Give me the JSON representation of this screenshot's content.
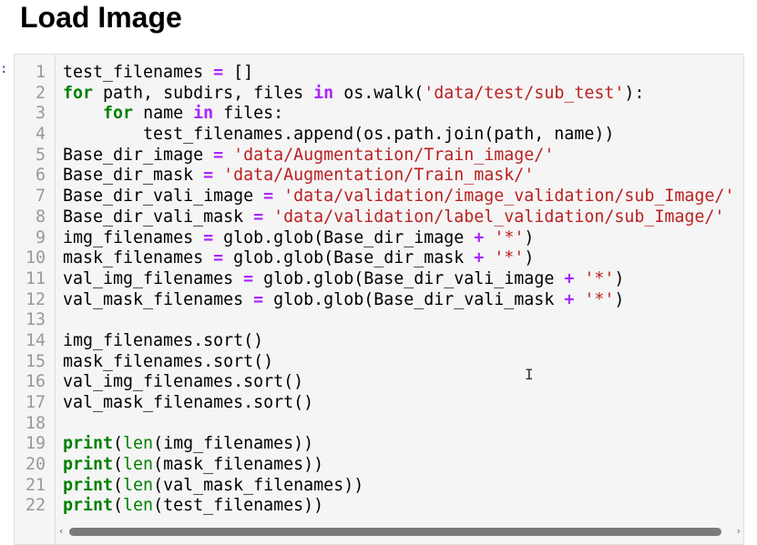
{
  "heading": "Load Image",
  "prompt": ":",
  "lines": [
    {
      "n": "1",
      "tokens": [
        [
          "t",
          "test_filenames "
        ],
        [
          "op",
          "="
        ],
        [
          "t",
          " []"
        ]
      ]
    },
    {
      "n": "2",
      "tokens": [
        [
          "kw",
          "for"
        ],
        [
          "t",
          " path, subdirs, files "
        ],
        [
          "op",
          "in"
        ],
        [
          "t",
          " os.walk("
        ],
        [
          "str",
          "'data/test/sub_test'"
        ],
        [
          "t",
          "):"
        ]
      ]
    },
    {
      "n": "3",
      "tokens": [
        [
          "t",
          "    "
        ],
        [
          "kw",
          "for"
        ],
        [
          "t",
          " name "
        ],
        [
          "op",
          "in"
        ],
        [
          "t",
          " files:"
        ]
      ]
    },
    {
      "n": "4",
      "tokens": [
        [
          "t",
          "        test_filenames.append(os.path.join(path, name))"
        ]
      ]
    },
    {
      "n": "5",
      "tokens": [
        [
          "t",
          "Base_dir_image "
        ],
        [
          "op",
          "="
        ],
        [
          "t",
          " "
        ],
        [
          "str",
          "'data/Augmentation/Train_image/'"
        ]
      ]
    },
    {
      "n": "6",
      "tokens": [
        [
          "t",
          "Base_dir_mask "
        ],
        [
          "op",
          "="
        ],
        [
          "t",
          " "
        ],
        [
          "str",
          "'data/Augmentation/Train_mask/'"
        ]
      ]
    },
    {
      "n": "7",
      "tokens": [
        [
          "t",
          "Base_dir_vali_image "
        ],
        [
          "op",
          "="
        ],
        [
          "t",
          " "
        ],
        [
          "str",
          "'data/validation/image_validation/sub_Image/'"
        ]
      ]
    },
    {
      "n": "8",
      "tokens": [
        [
          "t",
          "Base_dir_vali_mask "
        ],
        [
          "op",
          "="
        ],
        [
          "t",
          " "
        ],
        [
          "str",
          "'data/validation/label_validation/sub_Image/'"
        ]
      ]
    },
    {
      "n": "9",
      "tokens": [
        [
          "t",
          "img_filenames "
        ],
        [
          "op",
          "="
        ],
        [
          "t",
          " glob.glob(Base_dir_image "
        ],
        [
          "op",
          "+"
        ],
        [
          "t",
          " "
        ],
        [
          "str",
          "'*'"
        ],
        [
          "t",
          ")"
        ]
      ]
    },
    {
      "n": "10",
      "tokens": [
        [
          "t",
          "mask_filenames "
        ],
        [
          "op",
          "="
        ],
        [
          "t",
          " glob.glob(Base_dir_mask "
        ],
        [
          "op",
          "+"
        ],
        [
          "t",
          " "
        ],
        [
          "str",
          "'*'"
        ],
        [
          "t",
          ")"
        ]
      ]
    },
    {
      "n": "11",
      "tokens": [
        [
          "t",
          "val_img_filenames "
        ],
        [
          "op",
          "="
        ],
        [
          "t",
          " glob.glob(Base_dir_vali_image "
        ],
        [
          "op",
          "+"
        ],
        [
          "t",
          " "
        ],
        [
          "str",
          "'*'"
        ],
        [
          "t",
          ")"
        ]
      ]
    },
    {
      "n": "12",
      "tokens": [
        [
          "t",
          "val_mask_filenames "
        ],
        [
          "op",
          "="
        ],
        [
          "t",
          " glob.glob(Base_dir_vali_mask "
        ],
        [
          "op",
          "+"
        ],
        [
          "t",
          " "
        ],
        [
          "str",
          "'*'"
        ],
        [
          "t",
          ")"
        ]
      ]
    },
    {
      "n": "13",
      "tokens": []
    },
    {
      "n": "14",
      "tokens": [
        [
          "t",
          "img_filenames.sort()"
        ]
      ]
    },
    {
      "n": "15",
      "tokens": [
        [
          "t",
          "mask_filenames.sort()"
        ]
      ]
    },
    {
      "n": "16",
      "tokens": [
        [
          "t",
          "val_img_filenames.sort()"
        ]
      ]
    },
    {
      "n": "17",
      "tokens": [
        [
          "t",
          "val_mask_filenames.sort()"
        ]
      ]
    },
    {
      "n": "18",
      "tokens": []
    },
    {
      "n": "19",
      "tokens": [
        [
          "kw",
          "print"
        ],
        [
          "t",
          "("
        ],
        [
          "bi",
          "len"
        ],
        [
          "t",
          "(img_filenames))"
        ]
      ]
    },
    {
      "n": "20",
      "tokens": [
        [
          "kw",
          "print"
        ],
        [
          "t",
          "("
        ],
        [
          "bi",
          "len"
        ],
        [
          "t",
          "(mask_filenames))"
        ]
      ]
    },
    {
      "n": "21",
      "tokens": [
        [
          "kw",
          "print"
        ],
        [
          "t",
          "("
        ],
        [
          "bi",
          "len"
        ],
        [
          "t",
          "(val_mask_filenames))"
        ]
      ]
    },
    {
      "n": "22",
      "tokens": [
        [
          "kw",
          "print"
        ],
        [
          "t",
          "("
        ],
        [
          "bi",
          "len"
        ],
        [
          "t",
          "(test_filenames))"
        ]
      ]
    }
  ],
  "scrollbar": {
    "left_arrow": "‹",
    "right_arrow": "›"
  },
  "cursor_glyph": "I",
  "colors": {
    "keyword": "#008000",
    "operator": "#aa22ff",
    "string": "#ba2121",
    "line_number": "#999999",
    "cell_background": "#f5f5f5"
  }
}
